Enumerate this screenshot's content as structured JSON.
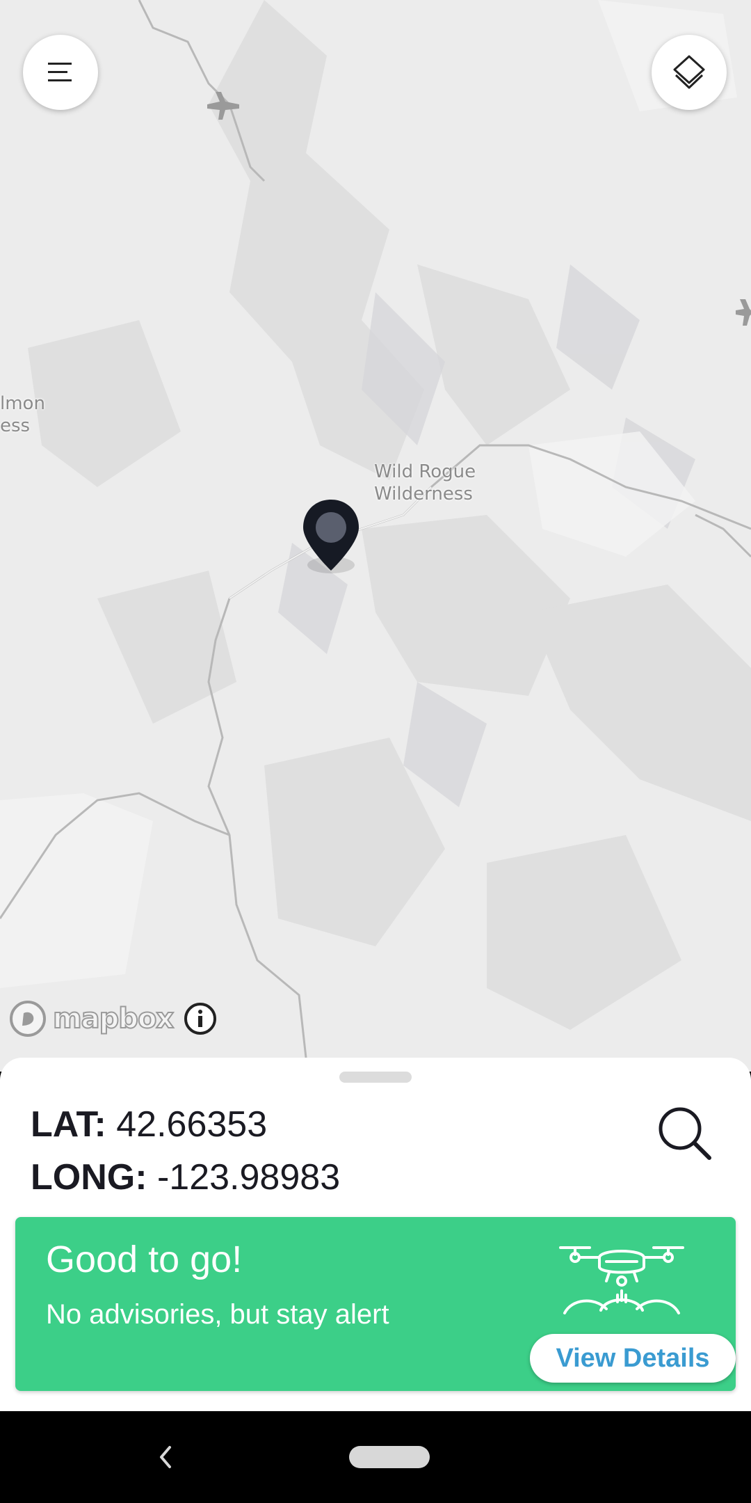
{
  "map": {
    "labels": {
      "wilderness_line1": "Wild Rogue",
      "wilderness_line2": "Wilderness",
      "partial_line1": "lmon",
      "partial_line2": "ess"
    },
    "attribution": "mapbox",
    "colors": {
      "land": "#ececec",
      "pin": "#161a24"
    }
  },
  "controls": {
    "menu_icon": "hamburger-menu-icon",
    "layers_icon": "layers-icon",
    "info_icon": "info-icon",
    "search_icon": "search-icon"
  },
  "coordinates": {
    "lat_label": "LAT:",
    "lat_value": "42.66353",
    "long_label": "LONG:",
    "long_value": "-123.98983"
  },
  "status": {
    "title": "Good to go!",
    "subtitle": "No advisories, but stay alert",
    "button_label": "View Details",
    "color": "#3ccf88",
    "button_text_color": "#3a9bd1",
    "icon": "drone-icon"
  },
  "navbar": {
    "back_icon": "back-chevron-icon",
    "home_icon": "home-pill-icon"
  }
}
